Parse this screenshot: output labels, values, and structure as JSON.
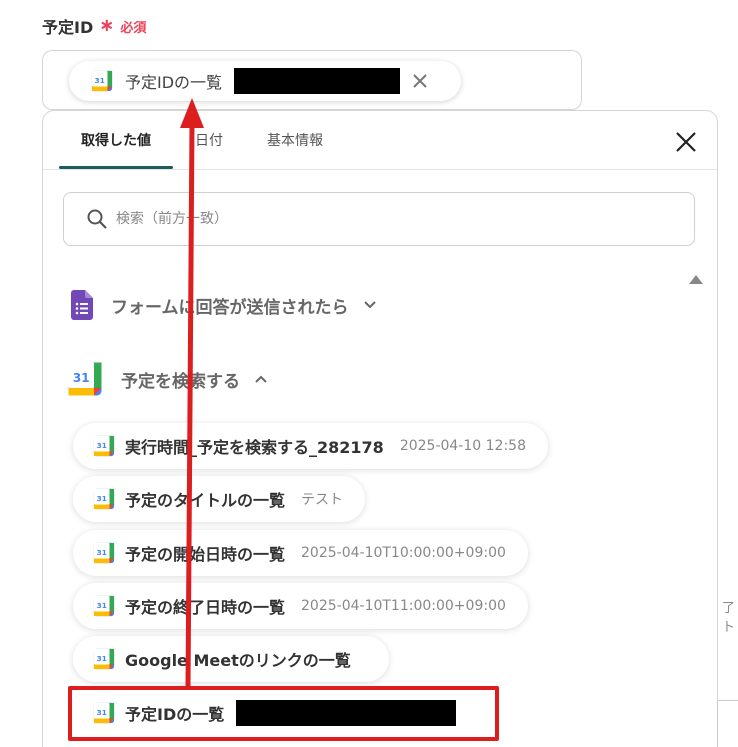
{
  "field": {
    "label": "予定ID",
    "required_mark": "∗",
    "required_text": "必須",
    "token_label": "予定IDの一覧"
  },
  "panel": {
    "tabs": [
      {
        "label": "取得した値",
        "active": true
      },
      {
        "label": "日付",
        "active": false
      },
      {
        "label": "基本情報",
        "active": false
      }
    ],
    "search_placeholder": "検索（前方一致）",
    "sections": [
      {
        "name": "フォームに回答が送信されたら",
        "expanded": false,
        "icon": "google-forms-icon"
      },
      {
        "name": "予定を検索する",
        "expanded": true,
        "icon": "google-calendar-icon"
      }
    ],
    "items": [
      {
        "label": "実行時間_予定を検索する_282178",
        "value": "2025-04-10 12:58"
      },
      {
        "label": "予定のタイトルの一覧",
        "value": "テスト"
      },
      {
        "label": "予定の開始日時の一覧",
        "value": "2025-04-10T10:00:00+09:00"
      },
      {
        "label": "予定の終了日時の一覧",
        "value": "2025-04-10T11:00:00+09:00"
      },
      {
        "label": "Google Meetのリンクの一覧",
        "value": ""
      },
      {
        "label": "予定IDの一覧",
        "value": ""
      }
    ]
  },
  "side_text": "了ト",
  "colors": {
    "accent_tab": "#1e5a5e",
    "required": "#e8455a",
    "highlight": "#dd1e1e",
    "forms_purple": "#7248b9"
  }
}
